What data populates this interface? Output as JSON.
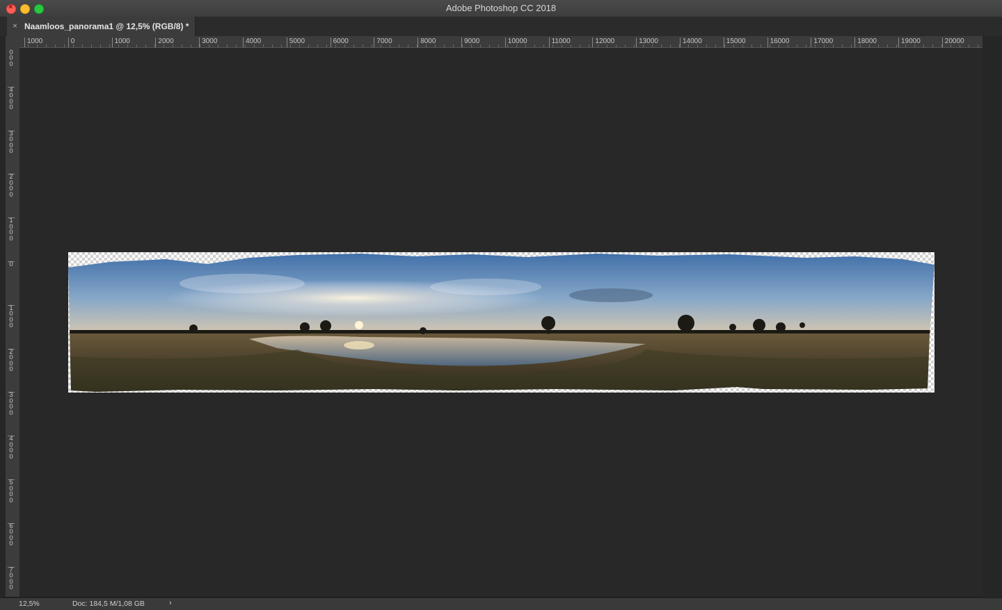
{
  "window": {
    "title": "Adobe Photoshop CC 2018"
  },
  "tab": {
    "label": "Naamloos_panorama1 @ 12,5% (RGB/8) *",
    "close_glyph": "×"
  },
  "ruler_horizontal": [
    "1000",
    "0",
    "1000",
    "2000",
    "3000",
    "4000",
    "5000",
    "6000",
    "7000",
    "8000",
    "9000",
    "10000",
    "11000",
    "12000",
    "13000",
    "14000",
    "15000",
    "16000",
    "17000",
    "18000",
    "19000",
    "20000"
  ],
  "ruler_vertical": [
    "5000",
    "4000",
    "3000",
    "2000",
    "1000",
    "0",
    "1000",
    "2000",
    "3000",
    "4000",
    "5000",
    "6000",
    "7000"
  ],
  "status": {
    "zoom": "12,5%",
    "doc_info": "Doc: 184,5 M/1,08 GB",
    "arrow": "›"
  },
  "colors": {
    "close": "#ff5f57",
    "minimize": "#febc2e",
    "maximize": "#28c840",
    "canvas_bg": "#282828"
  }
}
